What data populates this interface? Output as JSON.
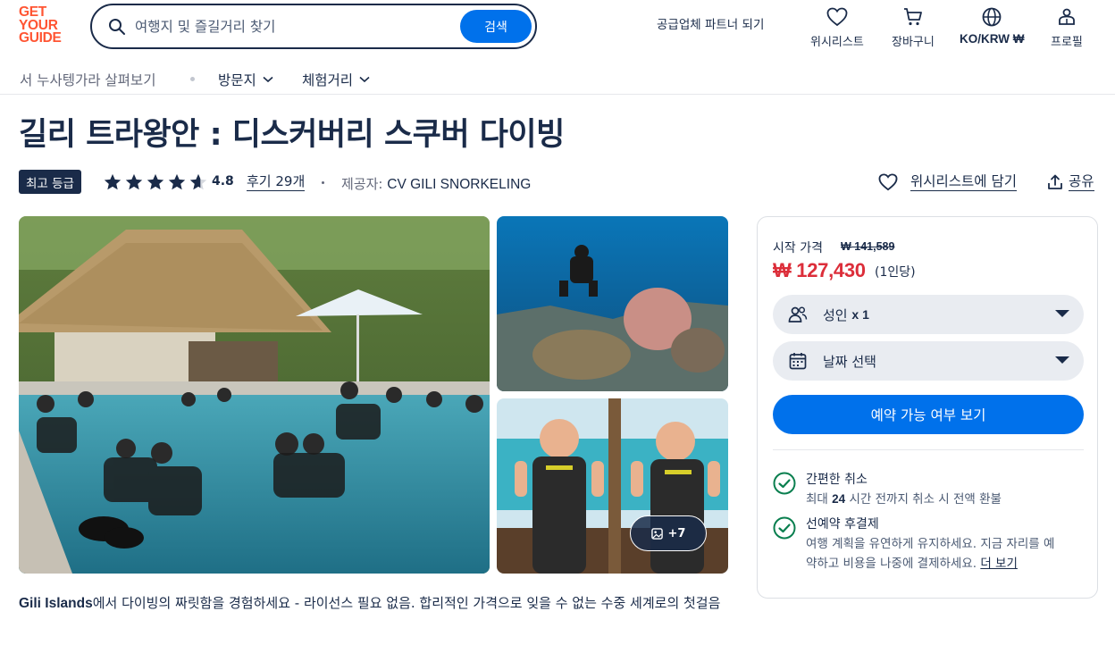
{
  "header": {
    "logo": [
      "GET",
      "YOUR",
      "GUIDE"
    ],
    "search_placeholder": "여행지 및 즐길거리 찾기",
    "search_button": "검색",
    "partner_link": "공급업체 파트너 되기",
    "nav": [
      {
        "label": "위시리스트",
        "icon": "heart-icon"
      },
      {
        "label": "장바구니",
        "icon": "cart-icon"
      },
      {
        "label": "KO/KRW ₩",
        "icon": "globe-icon"
      },
      {
        "label": "프로필",
        "icon": "profile-icon"
      }
    ]
  },
  "subnav": {
    "breadcrumb": "서 누사텡가라 살펴보기",
    "dropdowns": [
      "방문지",
      "체험거리"
    ]
  },
  "product": {
    "title": "길리 트라왕안 : 디스커버리 스쿠버 다이빙",
    "badge": "최고 등급",
    "rating": "4.8",
    "rating_value": 4.8,
    "reviews": "후기 29개",
    "provider_label": "제공자:",
    "provider_name": "CV GILI SNORKELING",
    "wishlist_label": "위시리스트에 담기",
    "share_label": "공유",
    "more_photos": "+7",
    "description_bold": "Gili Islands",
    "description": "에서 다이빙의 짜릿함을 경험하세요 - 라이선스 필요 없음. 합리적인 가격으로 잊을 수 없는 수중 세계로의 첫걸음"
  },
  "booking": {
    "from_label": "시작 가격",
    "old_price": "₩ 141,589",
    "price": "₩ 127,430",
    "per_person": "(1인당)",
    "participants_label": "성인",
    "participants_count": "x 1",
    "date_label": "날짜 선택",
    "check_button": "예약 가능 여부 보기",
    "features": [
      {
        "title": "간편한 취소",
        "pre": "최대",
        "hours": "24",
        "post": "시간 전까지 취소 시 전액 환불"
      },
      {
        "title": "선예약 후결제",
        "text1": "여행 계획을 유연하게 유지하세요. 지금 자리를 예",
        "text2": "약하고 비용을 나중에 결제하세요.",
        "more": "더 보기"
      }
    ]
  },
  "colors": {
    "brand": "#ff5533",
    "primary": "#0071eb",
    "text": "#1a2b49",
    "price": "#dc2e3a"
  }
}
